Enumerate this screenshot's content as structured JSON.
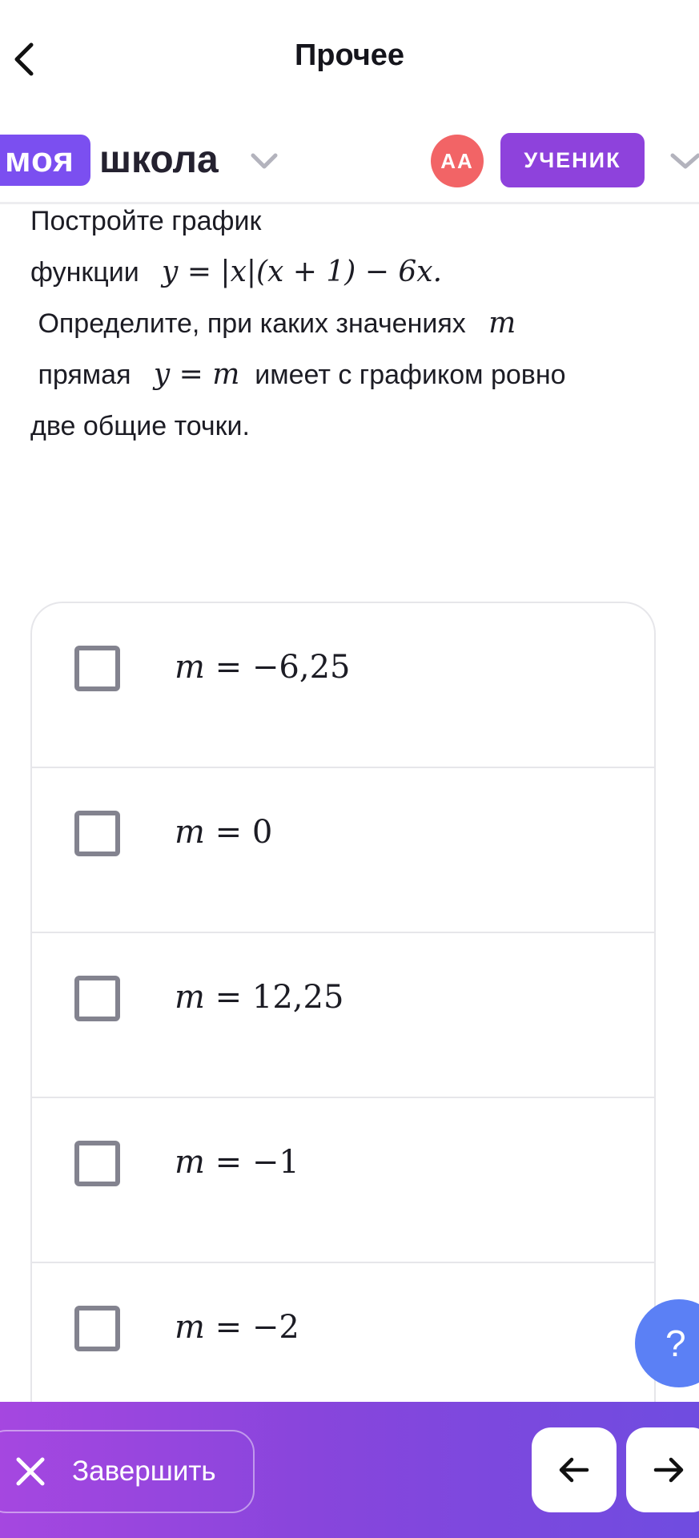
{
  "header": {
    "title": "Прочее",
    "back_icon": "chevron-left-icon"
  },
  "school": {
    "logo_part1": "моя",
    "logo_part2": "школа",
    "avatar_initials": "АА",
    "role_label": "УЧЕНИК",
    "brand_color": "#7b4ff0",
    "avatar_color": "#f26466",
    "role_color": "#8e42dc"
  },
  "question": {
    "line1": "Постройте график",
    "line2_text": "функции",
    "line2_formula": "y = |x|(x + 1) − 6x.",
    "line3_text": "Определите, при каких значениях",
    "line3_var": "m",
    "line4_text_a": "прямая",
    "line4_formula": "y = m",
    "line4_text_b": "имеет с графиком ровно",
    "line5": "две общие точки."
  },
  "options": [
    {
      "var": "m",
      "rest": " = −6,25",
      "checked": false
    },
    {
      "var": "m",
      "rest": " = 0",
      "checked": false
    },
    {
      "var": "m",
      "rest": " = 12,25",
      "checked": false
    },
    {
      "var": "m",
      "rest": " = −1",
      "checked": false
    },
    {
      "var": "m",
      "rest": " = −2",
      "checked": false
    }
  ],
  "help": {
    "label": "?"
  },
  "footer": {
    "finish_label": "Завершить",
    "prev_icon": "arrow-left-icon",
    "next_icon": "arrow-right-icon",
    "gradient_start": "#a547e0",
    "gradient_end": "#6f4ce0"
  }
}
